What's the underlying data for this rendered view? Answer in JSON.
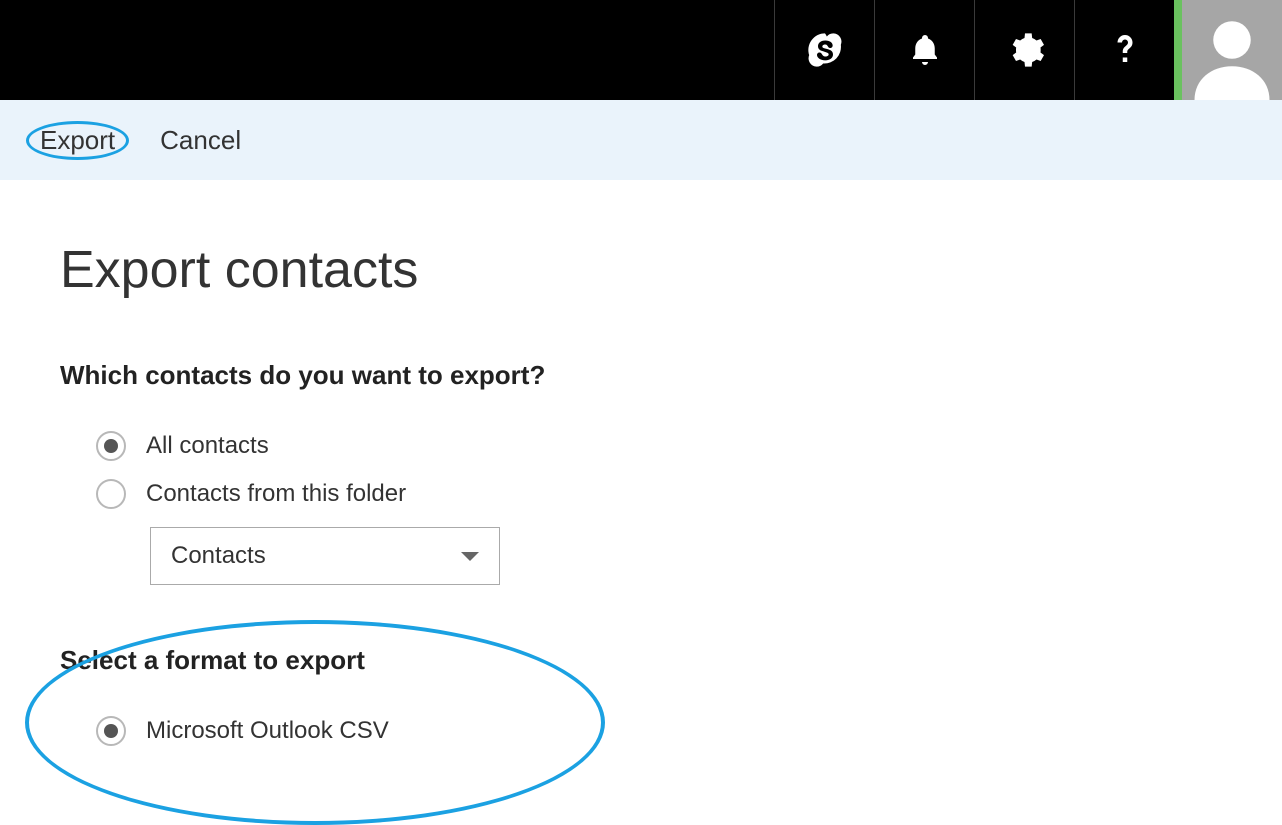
{
  "header": {
    "icons": [
      "skype-icon",
      "bell-icon",
      "gear-icon",
      "help-icon",
      "avatar-icon"
    ]
  },
  "action_bar": {
    "export_label": "Export",
    "cancel_label": "Cancel"
  },
  "page": {
    "title": "Export contacts",
    "question1": "Which contacts do you want to export?",
    "radio_all_label": "All contacts",
    "radio_folder_label": "Contacts from this folder",
    "folder_dropdown_value": "Contacts",
    "question2": "Select a format to export",
    "radio_format_csv_label": "Microsoft Outlook CSV"
  },
  "colors": {
    "accent": "#1ba1e2",
    "green_strip": "#6ac25f"
  }
}
